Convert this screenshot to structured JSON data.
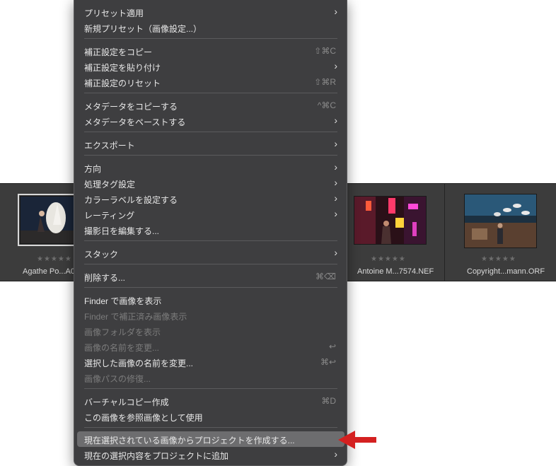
{
  "filmstrip": {
    "items": [
      {
        "name": "Agathe Po...A0",
        "stars": "★★★★★",
        "selected": true
      },
      {
        "name": "Antoine M...7574.NEF",
        "stars": "★★★★★",
        "selected": false
      },
      {
        "name": "Copyright...mann.ORF",
        "stars": "★★★★★",
        "selected": false
      }
    ]
  },
  "menu": {
    "items": [
      {
        "label": "プリセット適用",
        "submenu": true
      },
      {
        "label": "新規プリセット（画像設定...）"
      },
      {
        "label": "補正設定をコピー",
        "shortcut": "⇧⌘C"
      },
      {
        "label": "補正設定を貼り付け",
        "submenu": true
      },
      {
        "label": "補正設定のリセット",
        "shortcut": "⇧⌘R"
      },
      {
        "label": "メタデータをコピーする",
        "shortcut": "^⌘C"
      },
      {
        "label": "メタデータをペーストする",
        "submenu": true
      },
      {
        "label": "エクスポート",
        "submenu": true
      },
      {
        "label": "方向",
        "submenu": true
      },
      {
        "label": "処理タグ設定",
        "submenu": true
      },
      {
        "label": "カラーラベルを設定する",
        "submenu": true
      },
      {
        "label": "レーティング",
        "submenu": true
      },
      {
        "label": "撮影日を編集する..."
      },
      {
        "label": "スタック",
        "submenu": true
      },
      {
        "label": "削除する...",
        "shortcut": "⌘⌫"
      },
      {
        "label": "Finder で画像を表示"
      },
      {
        "label": "Finder で補正済み画像表示",
        "disabled": true
      },
      {
        "label": "画像フォルダを表示",
        "disabled": true
      },
      {
        "label": "画像の名前を変更...",
        "disabled": true,
        "shortcut": "↩"
      },
      {
        "label": "選択した画像の名前を変更...",
        "shortcut": "⌘↩"
      },
      {
        "label": "画像パスの修復...",
        "disabled": true
      },
      {
        "label": "バーチャルコピー作成",
        "shortcut": "⌘D"
      },
      {
        "label": "この画像を参照画像として使用"
      },
      {
        "label": "現在選択されている画像からプロジェクトを作成する...",
        "highlighted": true
      },
      {
        "label": "現在の選択内容をプロジェクトに追加",
        "submenu": true
      }
    ]
  },
  "colors": {
    "menu_bg": "#3e3e40",
    "highlight": "#6d6d6f",
    "arrow": "#d42020"
  }
}
